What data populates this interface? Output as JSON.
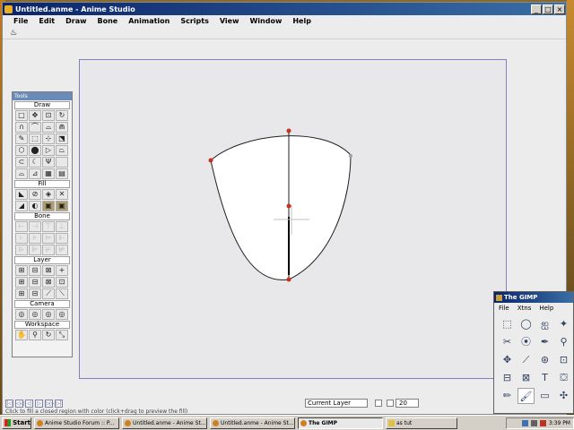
{
  "window": {
    "title": "Untitled.anme - Anime Studio",
    "buttons": [
      "_",
      "□",
      "×"
    ]
  },
  "menubar": [
    "File",
    "Edit",
    "Draw",
    "Bone",
    "Animation",
    "Scripts",
    "View",
    "Window",
    "Help"
  ],
  "tool_options": {
    "icon": "paint-bucket-icon",
    "glyph": "♨"
  },
  "tools_palette": {
    "title": "Tools",
    "sections": [
      {
        "label": "Draw",
        "rows": 6,
        "glyphs": [
          "□",
          "✥",
          "⊡",
          "↻",
          "∩",
          "⌒",
          "⌓",
          "⋒",
          "✎",
          "⬚",
          "⊹",
          "⬔",
          "⬡",
          "⬤",
          "▷",
          "⏢",
          "⊂",
          "☾",
          "Ψ",
          "",
          "⌓",
          "⊿",
          "▦",
          "▤"
        ]
      },
      {
        "label": "Fill",
        "rows": 2,
        "glyphs": [
          "◣",
          "⊘",
          "◈",
          "✕",
          "◢",
          "◐",
          "▣",
          "▣"
        ]
      },
      {
        "label": "Bone",
        "rows": 3,
        "glyphs": [
          "⊢",
          "⊣",
          "⊤",
          "⊥",
          "⊦",
          "⊧",
          "⊨",
          "⊩",
          "⊪",
          "⊫",
          "⊬",
          "⊭"
        ]
      },
      {
        "label": "Layer",
        "rows": 3,
        "glyphs": [
          "⊞",
          "⊟",
          "⊠",
          "+",
          "⊞",
          "⊟",
          "⊠",
          "⊡",
          "⊞",
          "⊟",
          "⟋",
          "⟍"
        ]
      },
      {
        "label": "Camera",
        "rows": 1,
        "glyphs": [
          "◎",
          "◎",
          "◎",
          "◎"
        ]
      },
      {
        "label": "Workspace",
        "rows": 1,
        "glyphs": [
          "✋",
          "⚲",
          "↻",
          "⤡"
        ]
      }
    ]
  },
  "canvas": {
    "shape_color": "#ffffff",
    "outline_color": "#202020",
    "point_color": "#c83020"
  },
  "timeline": {
    "buttons": [
      "|◁",
      "◁◁",
      "◁",
      "▷",
      "▷▷",
      "▷|"
    ],
    "layer_select": "Current Layer",
    "frame": "20"
  },
  "status_text": "Click to fill a closed region with color (click+drag to preview the fill)",
  "gimp": {
    "title": "The GIMP",
    "menu": [
      "File",
      "Xtns",
      "Help"
    ],
    "tools": [
      "⬚",
      "◯",
      "ஐ",
      "✦",
      "✂",
      "⦿",
      "✒",
      "⚲",
      "✥",
      "⟋",
      "⊛",
      "⊡",
      "⊟",
      "⊠",
      "T",
      "⛋",
      "✏",
      "🖌",
      "▭",
      "✣"
    ]
  },
  "taskbar": {
    "start": "Start",
    "tasks": [
      {
        "label": "Anime Studio Forum :: P...",
        "active": false
      },
      {
        "label": "Untitled.anme - Anime St...",
        "active": false
      },
      {
        "label": "Untitled.anme - Anime St...",
        "active": false
      },
      {
        "label": "The GIMP",
        "active": true
      },
      {
        "label": "as tut",
        "active": false
      }
    ],
    "clock": "3:39 PM"
  }
}
